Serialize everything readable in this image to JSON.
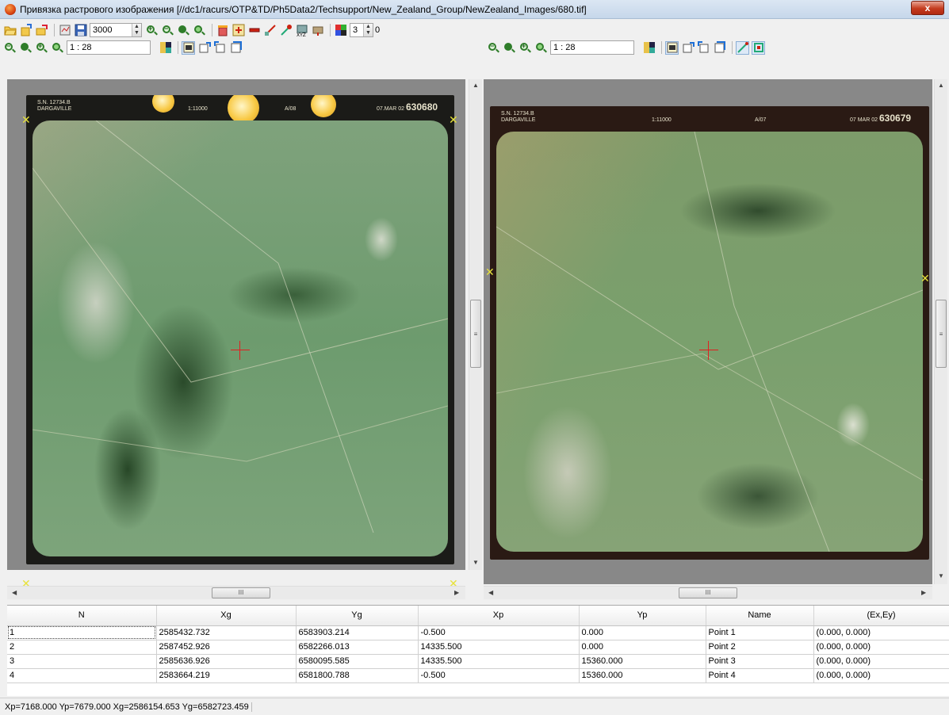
{
  "window": {
    "title": "Привязка растрового изображения [//dc1/racurs/OTP&TD/Ph5Data2/Techsupport/New_Zealand_Group/NewZealand_Images/680.tif]",
    "close_label": "x"
  },
  "toolbar": {
    "size_value": "3000",
    "bands_value": "3",
    "offset_value": "0"
  },
  "left_view": {
    "scale": "1 : 28",
    "photo_header": {
      "serial": "S.N. 12734.B",
      "place": "DARGAVILLE",
      "scale_text": "1:11000",
      "run": "A/08",
      "date": "07.MAR 02",
      "frame_no": "630680"
    }
  },
  "right_view": {
    "scale": "1 : 28",
    "photo_header": {
      "serial": "S.N. 12734.B",
      "place": "DARGAVILLE",
      "scale_text": "1:11000",
      "run": "A/07",
      "date": "07 MAR 02",
      "frame_no": "630679"
    }
  },
  "scroll": {
    "vthumb_label": "≡",
    "hthumb_label": "III"
  },
  "table": {
    "columns": [
      "N",
      "Xg",
      "Yg",
      "Xp",
      "Yp",
      "Name",
      "(Ex,Ey)"
    ],
    "rows": [
      [
        "1",
        "2585432.732",
        "6583903.214",
        "-0.500",
        "0.000",
        "Point 1",
        "(0.000, 0.000)"
      ],
      [
        "2",
        "2587452.926",
        "6582266.013",
        "14335.500",
        "0.000",
        "Point 2",
        "(0.000, 0.000)"
      ],
      [
        "3",
        "2585636.926",
        "6580095.585",
        "14335.500",
        "15360.000",
        "Point 3",
        "(0.000, 0.000)"
      ],
      [
        "4",
        "2583664.219",
        "6581800.788",
        "-0.500",
        "15360.000",
        "Point 4",
        "(0.000, 0.000)"
      ]
    ]
  },
  "status": {
    "text": "Xp=7168.000  Yp=7679.000  Xg=2586154.653  Yg=6582723.459"
  }
}
